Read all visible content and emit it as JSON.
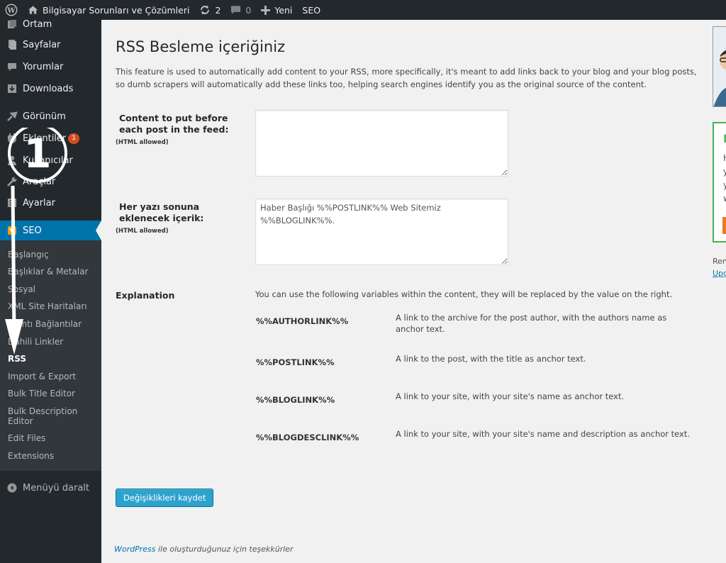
{
  "adminbar": {
    "site_name": "Bilgisayar Sorunları ve Çözümleri",
    "updates_count": "2",
    "comments_count": "0",
    "new_label": "Yeni",
    "seo_label": "SEO"
  },
  "sidebar": {
    "items": [
      {
        "label": "Ortam",
        "icon": "media-icon"
      },
      {
        "label": "Sayfalar",
        "icon": "pages-icon"
      },
      {
        "label": "Yorumlar",
        "icon": "comments-icon"
      },
      {
        "label": "Downloads",
        "icon": "download-icon"
      },
      {
        "label": "Görünüm",
        "icon": "appearance-icon"
      },
      {
        "label": "Eklentiler",
        "icon": "plugins-icon",
        "badge": "1"
      },
      {
        "label": "Kullanıcılar",
        "icon": "users-icon"
      },
      {
        "label": "Araçlar",
        "icon": "tools-icon"
      },
      {
        "label": "Ayarlar",
        "icon": "settings-icon"
      },
      {
        "label": "SEO",
        "icon": "seo-icon"
      }
    ],
    "submenu": [
      "Başlangıç",
      "Başlıklar & Metalar",
      "Sosyal",
      "XML Site Haritaları",
      "Kırıntı Bağlantılar",
      "Dahili Linkler",
      "RSS",
      "Import & Export",
      "Bulk Title Editor",
      "Bulk Description Editor",
      "Edit Files",
      "Extensions"
    ],
    "collapse_label": "Menüyü daralt",
    "accent_color": "#0073aa"
  },
  "annotation": {
    "step_number": "1"
  },
  "main": {
    "title": "RSS Besleme içeriğiniz",
    "intro": "This feature is used to automatically add content to your RSS, more specifically, it's meant to add links back to your blog and your blog posts, so dumb scrapers will automatically add these links too, helping search engines identify you as the original source of the content.",
    "before_label": "Content to put before each post in the feed:",
    "before_hint": "(HTML allowed)",
    "before_value": "",
    "after_label": "Her yazı sonuna eklenecek içerik:",
    "after_hint": "(HTML allowed)",
    "after_value": "Haber Başlığı %%POSTLINK%% Web Sitemiz %%BLOGLINK%%.",
    "explanation_label": "Explanation",
    "explanation_intro": "You can use the following variables within the content, they will be replaced by the value on the right.",
    "variables": [
      {
        "name": "%%AUTHORLINK%%",
        "desc": "A link to the archive for the post author, with the authors name as anchor text."
      },
      {
        "name": "%%POSTLINK%%",
        "desc": "A link to the post, with the title as anchor text."
      },
      {
        "name": "%%BLOGLINK%%",
        "desc": "A link to your site, with your site's name as anchor text."
      },
      {
        "name": "%%BLOGDESCLINK%%",
        "desc": "A link to your site, with your site's name and description as anchor text."
      }
    ],
    "save_label": "Değişiklikleri kaydet",
    "footer_link": "WordPress",
    "footer_text": " ile oluşturduğunuz için teşekkürler"
  },
  "right_panel": {
    "promo_letters": [
      "I",
      "H",
      "y",
      "y",
      "w"
    ],
    "text1": "Ren",
    "text2": "Upg"
  }
}
